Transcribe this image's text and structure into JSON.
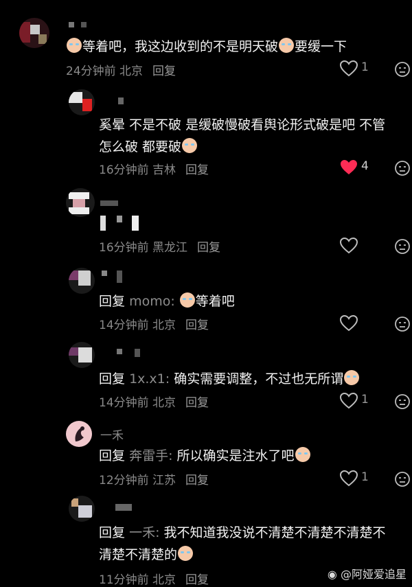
{
  "comments": [
    {
      "text": "等着吧，我这边收到的不是明天破",
      "text2": "要缓一下",
      "time": "24分钟前",
      "location": "北京",
      "reply": "回复",
      "likes": "1"
    },
    {
      "text": "奚晕 不是不破 是缓破慢破看舆论形式破是吧 不管",
      "text2": "怎么破 都要破",
      "time": "16分钟前",
      "location": "吉林",
      "reply": "回复",
      "likes": "4"
    },
    {
      "time": "16分钟前",
      "location": "黑龙江",
      "reply": "回复"
    },
    {
      "prefix": "回复",
      "mention": "momo:",
      "text": "等着吧",
      "time": "14分钟前",
      "location": "北京",
      "reply": "回复"
    },
    {
      "prefix": "回复",
      "mention": "1x.x1:",
      "text": "确实需要调整，不过也无所谓",
      "time": "14分钟前",
      "location": "北京",
      "reply": "回复",
      "likes": "1"
    },
    {
      "name": "一禾",
      "prefix": "回复",
      "mention": "奔雷手:",
      "text": "所以确实是注水了吧",
      "time": "12分钟前",
      "location": "江苏",
      "reply": "回复",
      "likes": "1"
    },
    {
      "prefix": "回复",
      "mention": "一禾:",
      "text": "我不知道我没说不清楚不清楚不清楚不",
      "text2": "清楚不清楚的",
      "time": "11分钟前",
      "location": "北京",
      "reply": "回复"
    }
  ],
  "watermark": "@阿娅爱追星",
  "colors": {
    "background": "#000000",
    "liked": "#fe2c55",
    "muted": "#8a8a8a"
  }
}
